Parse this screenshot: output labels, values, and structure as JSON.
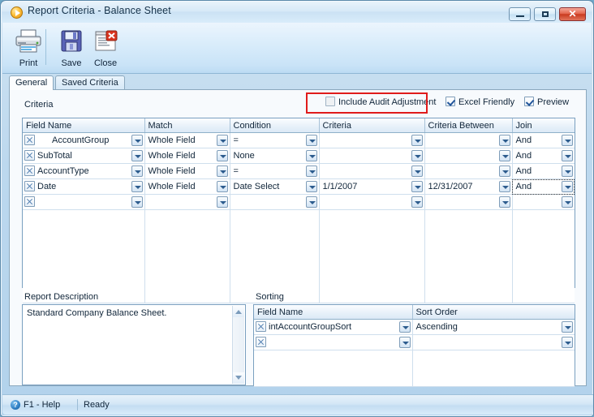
{
  "window": {
    "title": "Report Criteria - Balance Sheet",
    "icon": "report-play-icon",
    "minimize_label": "",
    "maximize_label": "",
    "close_label": "✕"
  },
  "toolbar": {
    "buttons": [
      {
        "name": "print",
        "label": "Print",
        "icon": "printer-icon"
      },
      {
        "name": "save",
        "label": "Save",
        "icon": "floppy-disk-icon"
      },
      {
        "name": "close",
        "label": "Close",
        "icon": "close-window-icon"
      }
    ]
  },
  "tabs": [
    {
      "name": "general",
      "label": "General",
      "active": true
    },
    {
      "name": "saved",
      "label": "Saved Criteria",
      "active": false
    }
  ],
  "options": {
    "include_audit_adjustment": {
      "label": "Include Audit Adjustment",
      "checked": false,
      "highlighted": true
    },
    "excel_friendly": {
      "label": "Excel Friendly",
      "checked": true
    },
    "preview": {
      "label": "Preview",
      "checked": true
    },
    "highlight_color": "#e01b1b"
  },
  "criteria": {
    "group_label": "Criteria",
    "columns": [
      "Field Name",
      "Match",
      "Condition",
      "Criteria",
      "Criteria Between",
      "Join"
    ],
    "rows": [
      {
        "field_name": "AccountGroup",
        "match": "Whole Field",
        "condition": "=",
        "criteria": "",
        "criteria_between": "",
        "join": "And"
      },
      {
        "field_name": "SubTotal",
        "match": "Whole Field",
        "condition": "None",
        "criteria": "",
        "criteria_between": "",
        "join": "And"
      },
      {
        "field_name": "AccountType",
        "match": "Whole Field",
        "condition": "=",
        "criteria": "",
        "criteria_between": "",
        "join": "And"
      },
      {
        "field_name": "Date",
        "match": "Whole Field",
        "condition": "Date Select",
        "criteria": "1/1/2007",
        "criteria_between": "12/31/2007",
        "join": "And"
      },
      {
        "field_name": "",
        "match": "",
        "condition": "",
        "criteria": "",
        "criteria_between": "",
        "join": ""
      }
    ],
    "focused_cell": {
      "row": 3,
      "column": "join"
    }
  },
  "report_description": {
    "label": "Report Description",
    "value": "Standard Company Balance Sheet."
  },
  "sorting": {
    "label": "Sorting",
    "columns": [
      "Field Name",
      "Sort Order"
    ],
    "rows": [
      {
        "field_name": "intAccountGroupSort",
        "sort_order": "Ascending"
      },
      {
        "field_name": "",
        "sort_order": ""
      }
    ]
  },
  "statusbar": {
    "help_icon": "question-mark-icon",
    "help_label": "F1 - Help",
    "status": "Ready"
  }
}
